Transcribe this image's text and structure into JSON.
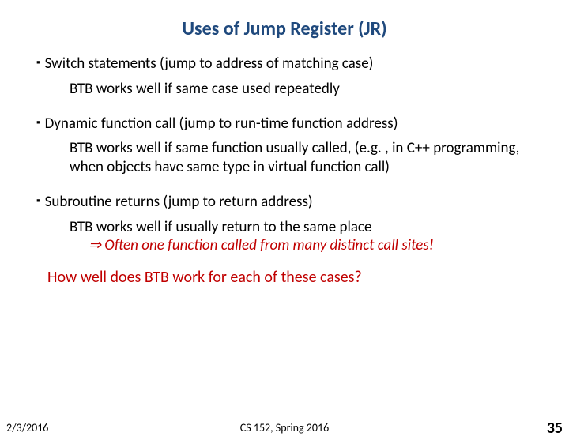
{
  "title": "Uses of Jump Register (JR)",
  "bullets": [
    {
      "text": "Switch statements (jump to address of matching case)",
      "sub": "BTB works well if same case used repeatedly"
    },
    {
      "text": "Dynamic function call (jump to run-time function address)",
      "sub": "BTB works well if same function usually called, (e.g. , in C++ programming, when objects have same type in virtual function call)"
    },
    {
      "text": "Subroutine returns (jump to return address)",
      "sub": "BTB works well if usually return to the same place",
      "subExtra": "⇒ Often one function called from many distinct call sites!"
    }
  ],
  "question": "How well does BTB work for each of these cases?",
  "footer": {
    "date": "2/3/2016",
    "course": "CS 152, Spring 2016",
    "page": "35"
  }
}
